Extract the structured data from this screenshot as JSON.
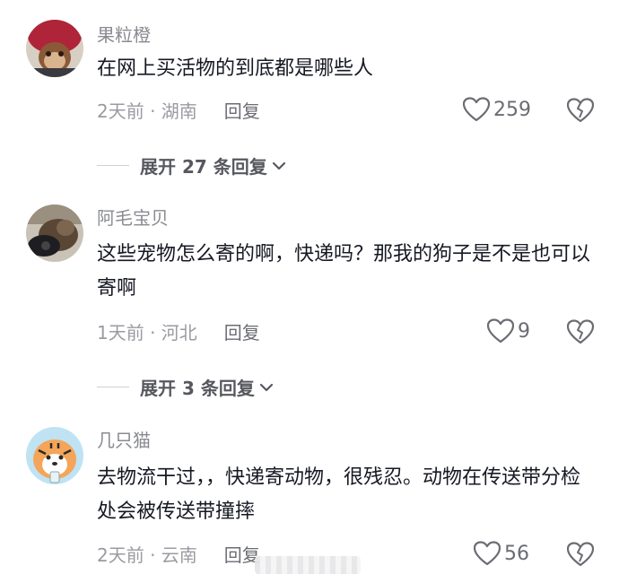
{
  "comments": [
    {
      "username": "果粒橙",
      "text": "在网上买活物的到底都是哪些人",
      "meta": "2天前 · 湖南",
      "reply_label": "回复",
      "likes": "259",
      "expand_label": "展开 27 条回复"
    },
    {
      "username": "阿毛宝贝",
      "text": "这些宠物怎么寄的啊，快递吗？那我的狗子是不是也可以寄啊",
      "meta": "1天前 · 河北",
      "reply_label": "回复",
      "likes": "9",
      "expand_label": "展开 3 条回复"
    },
    {
      "username": "几只猫",
      "text": "去物流干过，，快递寄动物，很残忍。动物在传送带分检处会被传送带撞摔",
      "meta": "2天前 · 云南",
      "reply_label": "回复",
      "likes": "56"
    }
  ],
  "icons": {
    "like": "heart-outline-icon",
    "dislike": "broken-heart-icon",
    "expand": "chevron-down-icon"
  },
  "colors": {
    "text": "#161823",
    "muted": "#8a8b91"
  }
}
